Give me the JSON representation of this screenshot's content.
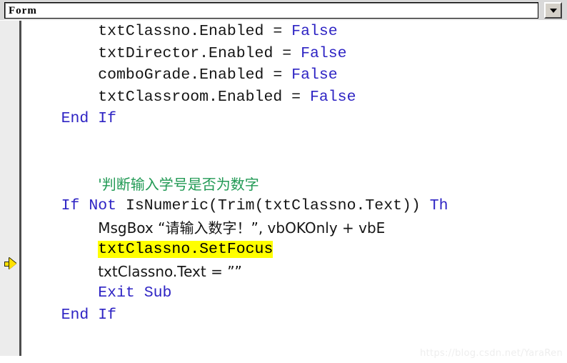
{
  "window": {
    "object_selector": {
      "value": "Form",
      "dropdown_icon": "chevron-down-icon"
    }
  },
  "editor": {
    "margin": {
      "execution_pointer_icon": "yellow-right-arrow-icon",
      "execution_pointer_line": 11
    },
    "highlighted_line_text": "txtClassno.SetFocus",
    "lines": [
      {
        "n": 1,
        "indent": "        ",
        "segments": [
          {
            "t": "txtClassno.Enabled = ",
            "k": "id"
          },
          {
            "t": "False",
            "k": "kw"
          }
        ]
      },
      {
        "n": 2,
        "indent": "        ",
        "segments": [
          {
            "t": "txtDirector.Enabled = ",
            "k": "id"
          },
          {
            "t": "False",
            "k": "kw"
          }
        ]
      },
      {
        "n": 3,
        "indent": "        ",
        "segments": [
          {
            "t": "comboGrade.Enabled = ",
            "k": "id"
          },
          {
            "t": "False",
            "k": "kw"
          }
        ]
      },
      {
        "n": 4,
        "indent": "        ",
        "segments": [
          {
            "t": "txtClassroom.Enabled = ",
            "k": "id"
          },
          {
            "t": "False",
            "k": "kw"
          }
        ]
      },
      {
        "n": 5,
        "indent": "    ",
        "segments": [
          {
            "t": "End If",
            "k": "kw"
          }
        ]
      },
      {
        "n": 6,
        "indent": "",
        "segments": []
      },
      {
        "n": 7,
        "indent": "",
        "segments": []
      },
      {
        "n": 8,
        "indent": "        ",
        "segments": [
          {
            "t": "'判断输入学号是否为数字",
            "k": "cmt"
          }
        ]
      },
      {
        "n": 9,
        "indent": "    ",
        "segments": [
          {
            "t": "If Not ",
            "k": "kw"
          },
          {
            "t": "IsNumeric(Trim(txtClassno.Text)) ",
            "k": "id"
          },
          {
            "t": "Th",
            "k": "kw"
          }
        ]
      },
      {
        "n": 10,
        "indent": "        ",
        "segments": [
          {
            "t": "MsgBox “请输入数字！”, vbOKOnly + vbE",
            "k": "id"
          }
        ]
      },
      {
        "n": 11,
        "indent": "        ",
        "segments": [
          {
            "t": "txtClassno.SetFocus",
            "k": "hl"
          }
        ]
      },
      {
        "n": 12,
        "indent": "        ",
        "segments": [
          {
            "t": "txtClassno.Text = ””",
            "k": "id"
          }
        ]
      },
      {
        "n": 13,
        "indent": "        ",
        "segments": [
          {
            "t": "Exit Sub",
            "k": "kw"
          }
        ]
      },
      {
        "n": 14,
        "indent": "    ",
        "segments": [
          {
            "t": "End If",
            "k": "kw"
          }
        ]
      }
    ]
  },
  "watermark": {
    "text": "https://blog.csdn.net/YaraRen"
  },
  "colors": {
    "keyword": "#2e24c4",
    "comment": "#229a55",
    "identifier": "#151515",
    "highlight_background": "#ffff00",
    "margin_background": "#ececec",
    "titlebar_background": "#d9d9d9",
    "execution_arrow": "#ffe000"
  }
}
